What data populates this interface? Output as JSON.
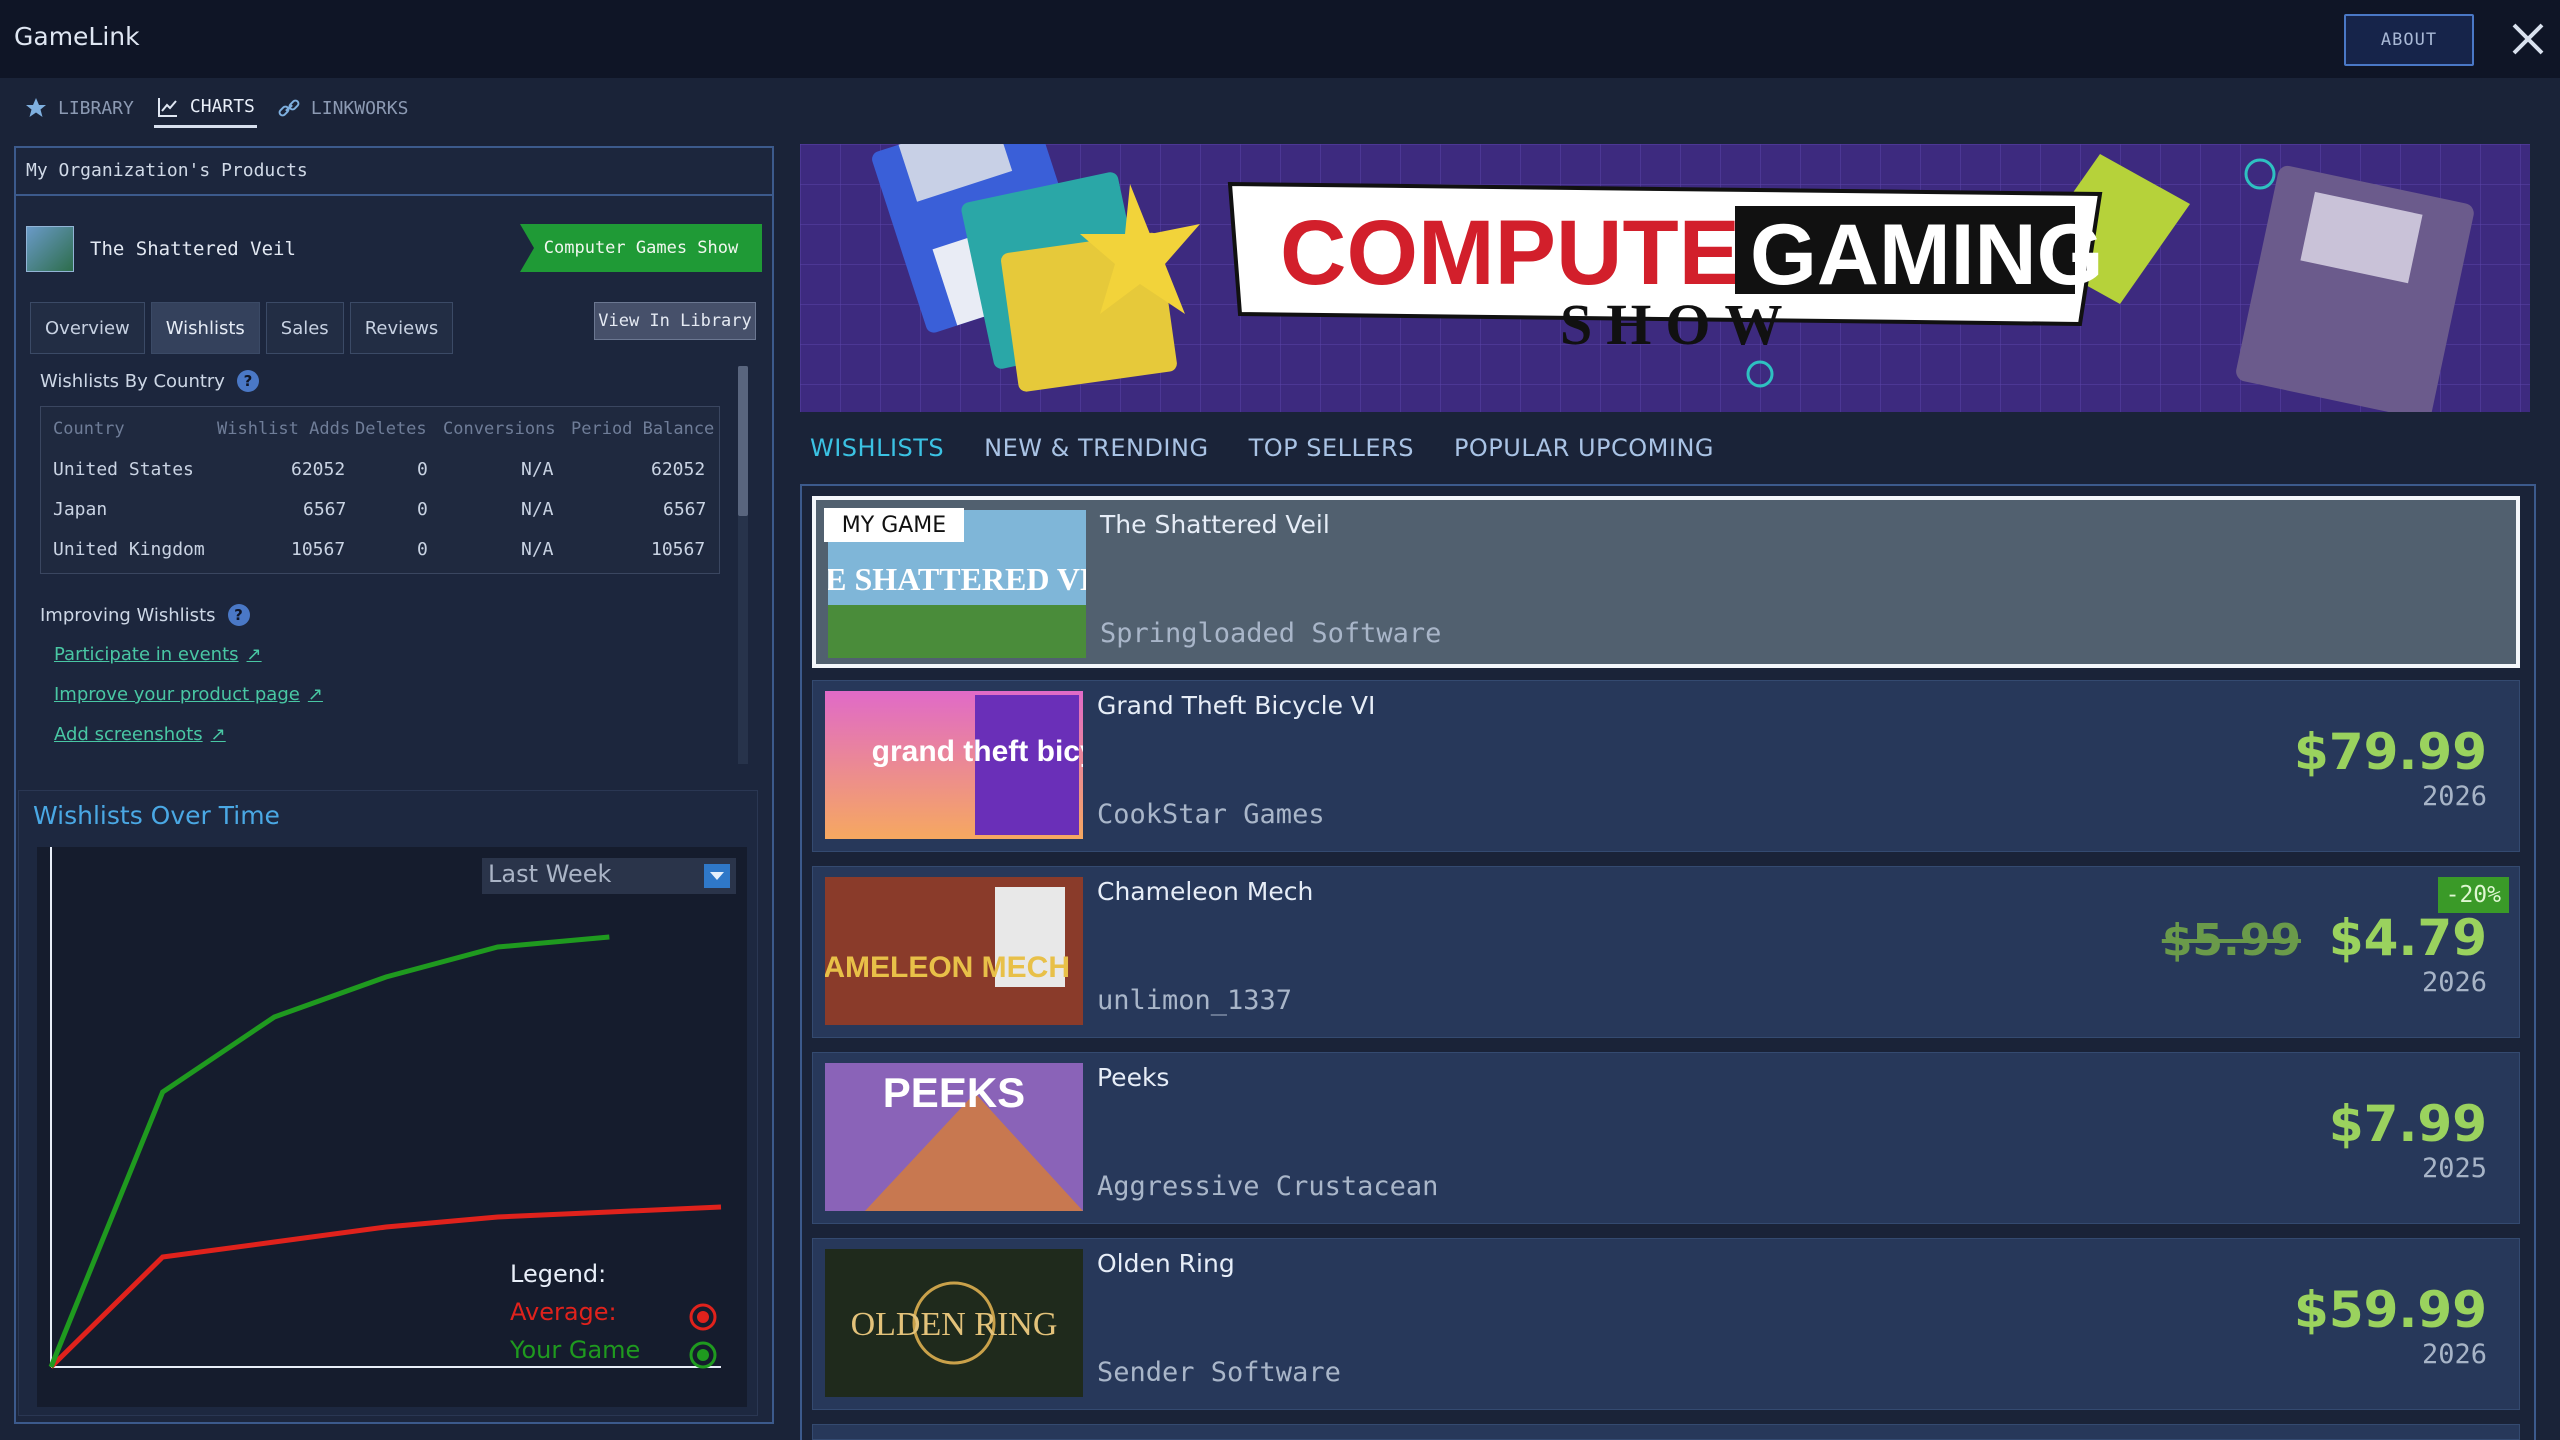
{
  "app": {
    "title": "GameLink",
    "about_label": "ABOUT"
  },
  "top_tabs": [
    {
      "label": "LIBRARY",
      "icon": "star-icon"
    },
    {
      "label": "CHARTS",
      "icon": "chart-icon",
      "active": true
    },
    {
      "label": "LINKWORKS",
      "icon": "link-icon"
    }
  ],
  "left": {
    "header": "My Organization's Products",
    "product": {
      "name": "The Shattered Veil",
      "event_badge": "Computer Games Show"
    },
    "subtabs": [
      "Overview",
      "Wishlists",
      "Sales",
      "Reviews"
    ],
    "active_subtab": "Wishlists",
    "view_library": "View In Library",
    "wishlists_by_country": {
      "title": "Wishlists By Country",
      "columns": [
        "Country",
        "Wishlist Adds",
        "Deletes",
        "Conversions",
        "Period Balance"
      ],
      "rows": [
        [
          "United States",
          "62052",
          "0",
          "N/A",
          "62052"
        ],
        [
          "Japan",
          "6567",
          "0",
          "N/A",
          "6567"
        ],
        [
          "United Kingdom",
          "10567",
          "0",
          "N/A",
          "10567"
        ]
      ]
    },
    "improving": {
      "title": "Improving Wishlists",
      "links": [
        "Participate in events",
        "Improve your product page",
        "Add screenshots"
      ]
    },
    "chart": {
      "title": "Wishlists Over Time",
      "period": "Last Week",
      "legend_title": "Legend:",
      "legend": [
        {
          "label": "Average:",
          "color": "#e0221c"
        },
        {
          "label": "Your Game",
          "color": "#1f9a1f"
        }
      ]
    }
  },
  "chart_data": {
    "type": "line",
    "x": [
      0,
      1,
      2,
      3,
      4,
      5,
      6
    ],
    "series": [
      {
        "name": "Average:",
        "color": "#e0221c",
        "values": [
          0,
          22,
          25,
          28,
          30,
          31,
          32
        ]
      },
      {
        "name": "Your Game",
        "color": "#1f9a1f",
        "values": [
          0,
          55,
          70,
          78,
          84,
          86,
          null
        ]
      }
    ],
    "ylim": [
      0,
      100
    ],
    "legend_position": "bottom-right",
    "grid": false
  },
  "banner": {
    "line1_left": "COMPUTER",
    "line1_right": "GAMING",
    "line2": "SHOW"
  },
  "store_tabs": [
    "WISHLISTS",
    "NEW & TRENDING",
    "TOP SELLERS",
    "POPULAR UPCOMING"
  ],
  "active_store_tab": "WISHLISTS",
  "games": [
    {
      "name": "The Shattered Veil",
      "developer": "Springloaded Software",
      "my_game": true,
      "badge": "MY GAME",
      "thumb_title": "THE SHATTERED VEIL"
    },
    {
      "name": "Grand Theft Bicycle VI",
      "developer": "CookStar Games",
      "price": "$79.99",
      "year": "2026",
      "thumb_title": "grand theft bicycle"
    },
    {
      "name": "Chameleon Mech",
      "developer": "unlimon_1337",
      "old_price": "$5.99",
      "price": "$4.79",
      "discount": "-20%",
      "year": "2026",
      "thumb_title": "CHAMELEON MECH"
    },
    {
      "name": "Peeks",
      "developer": "Aggressive Crustacean",
      "price": "$7.99",
      "year": "2025",
      "thumb_title": "PEEKS"
    },
    {
      "name": "Olden Ring",
      "developer": "Sender Software",
      "price": "$59.99",
      "year": "2026",
      "thumb_title": "OLDEN RING"
    }
  ]
}
